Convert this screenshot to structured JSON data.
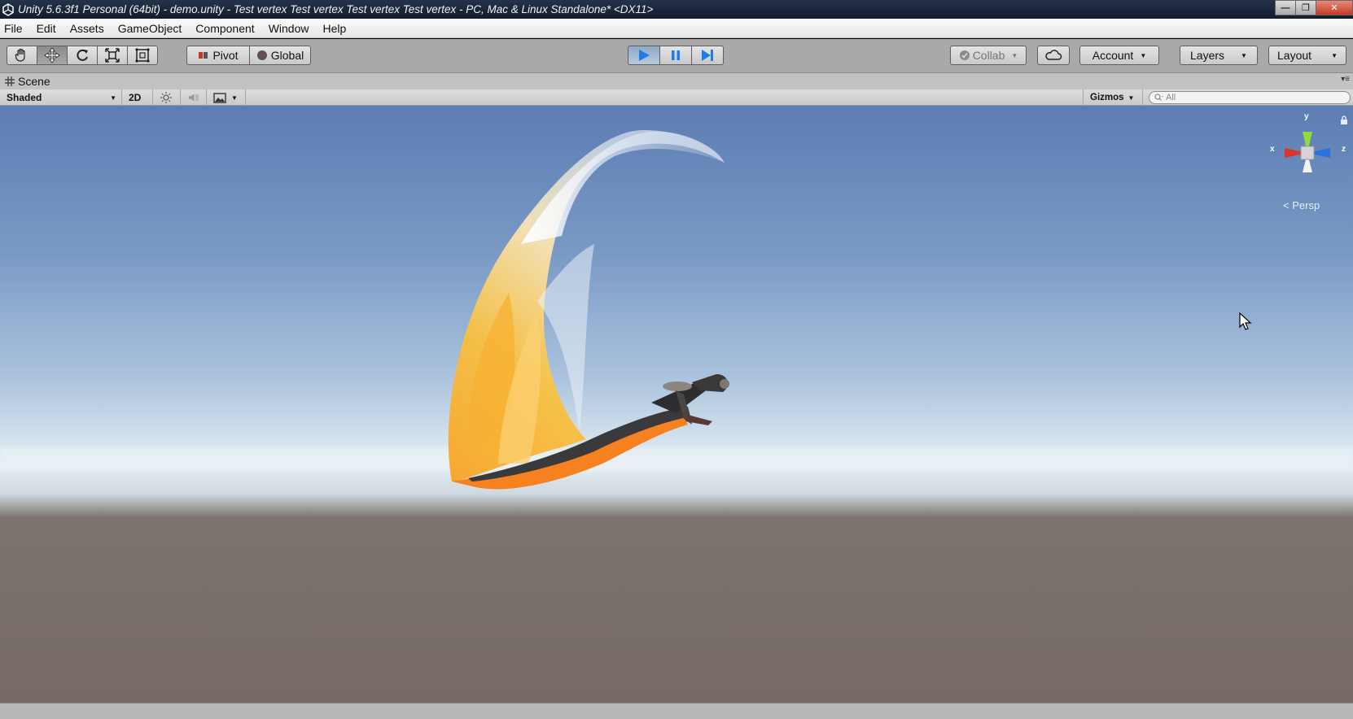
{
  "window": {
    "title": "Unity 5.6.3f1 Personal (64bit) - demo.unity - Test vertex Test vertex Test vertex Test vertex - PC, Mac & Linux Standalone* <DX11>",
    "minimize_glyph": "—",
    "maximize_glyph": "❐",
    "close_glyph": "✕"
  },
  "menu": [
    "File",
    "Edit",
    "Assets",
    "GameObject",
    "Component",
    "Window",
    "Help"
  ],
  "toolbar": {
    "transform_tools": [
      "hand-icon",
      "move-icon",
      "rotate-icon",
      "scale-icon",
      "rect-tool-icon"
    ],
    "active_tool": "move-icon",
    "pivot_label": "Pivot",
    "global_label": "Global",
    "play_state": "playing",
    "collab_label": "Collab",
    "account_label": "Account",
    "layers_label": "Layers",
    "layout_label": "Layout"
  },
  "scene_tab": {
    "label": "Scene"
  },
  "scene_bar": {
    "draw_mode": "Shaded",
    "mode_2d": "2D",
    "gizmos_label": "Gizmos",
    "search_placeholder": "All"
  },
  "gizmo": {
    "view_label": "Persp",
    "x_label": "x",
    "y_label": "y",
    "z_label": "z"
  },
  "colors": {
    "sky_top": "#5c7db3",
    "horizon": "#e3eef4",
    "ground": "#766b64",
    "axis_x": "#d9352a",
    "axis_y": "#8fdc3a",
    "axis_z": "#2c6fe0",
    "flame": "#f7a12a"
  }
}
